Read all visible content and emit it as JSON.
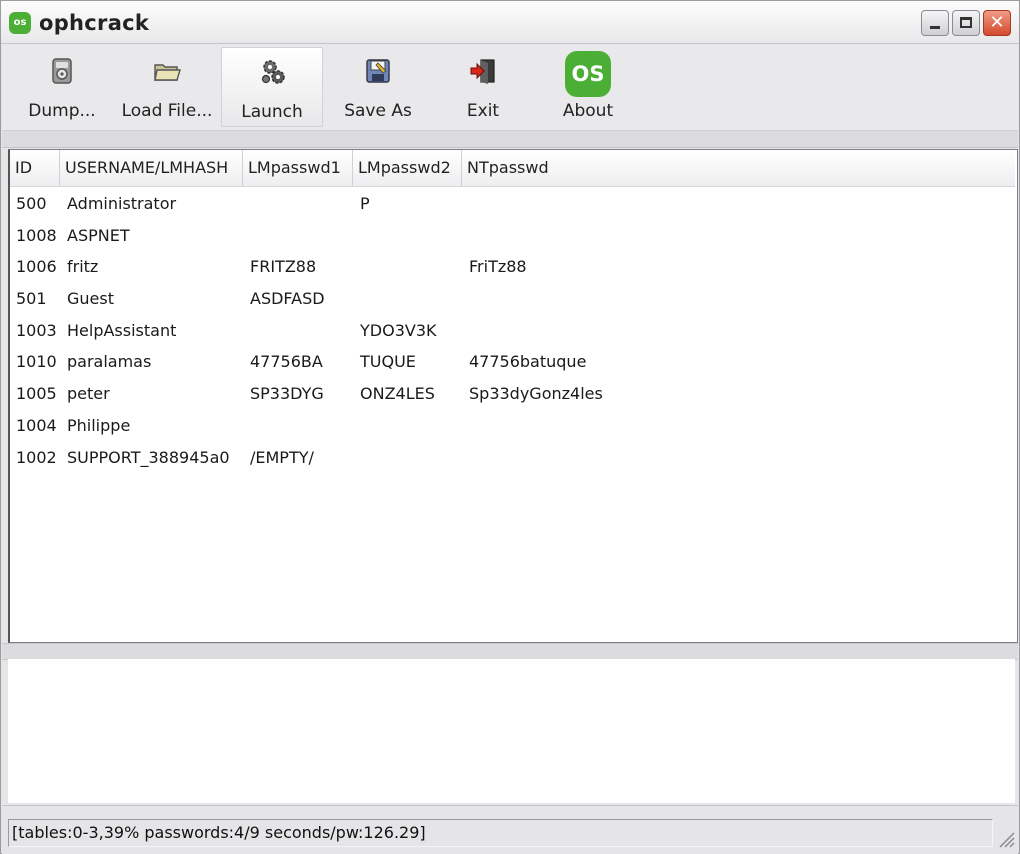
{
  "window": {
    "title": "ophcrack",
    "app_icon_text": "os",
    "close_glyph": "✕"
  },
  "toolbar": {
    "buttons": [
      {
        "label": "Dump...",
        "icon": "dump-icon"
      },
      {
        "label": "Load File...",
        "icon": "folder-icon"
      },
      {
        "label": "Launch",
        "icon": "gears-icon"
      },
      {
        "label": "Save As",
        "icon": "floppy-icon"
      },
      {
        "label": "Exit",
        "icon": "exit-icon"
      },
      {
        "label": "About",
        "icon": "about-os-icon",
        "icon_text": "OS"
      }
    ]
  },
  "table": {
    "columns": [
      "ID",
      "USERNAME/LMHASH",
      "LMpasswd1",
      "LMpasswd2",
      "NTpasswd"
    ],
    "rows": [
      {
        "id": "500",
        "user": "Administrator",
        "lm1": "",
        "lm2": "P",
        "nt": ""
      },
      {
        "id": "1008",
        "user": "ASPNET",
        "lm1": "",
        "lm2": "",
        "nt": ""
      },
      {
        "id": "1006",
        "user": "fritz",
        "lm1": "FRITZ88",
        "lm2": "",
        "nt": "FriTz88"
      },
      {
        "id": "501",
        "user": "Guest",
        "lm1": "ASDFASD",
        "lm2": "",
        "nt": ""
      },
      {
        "id": "1003",
        "user": "HelpAssistant",
        "lm1": "",
        "lm2": "YDO3V3K",
        "nt": ""
      },
      {
        "id": "1010",
        "user": "paralamas",
        "lm1": "47756BA",
        "lm2": "TUQUE",
        "nt": "47756batuque"
      },
      {
        "id": "1005",
        "user": "peter",
        "lm1": "SP33DYG",
        "lm2": "ONZ4LES",
        "nt": "Sp33dyGonz4les"
      },
      {
        "id": "1004",
        "user": "Philippe",
        "lm1": "",
        "lm2": "",
        "nt": ""
      },
      {
        "id": "1002",
        "user": "SUPPORT_388945a0",
        "lm1": "/EMPTY/",
        "lm2": "",
        "nt": ""
      }
    ]
  },
  "status": {
    "text": "[tables:0-3,39% passwords:4/9  seconds/pw:126.29]"
  },
  "colors": {
    "accent_green": "#4caf35",
    "close_red": "#d24a2d"
  }
}
